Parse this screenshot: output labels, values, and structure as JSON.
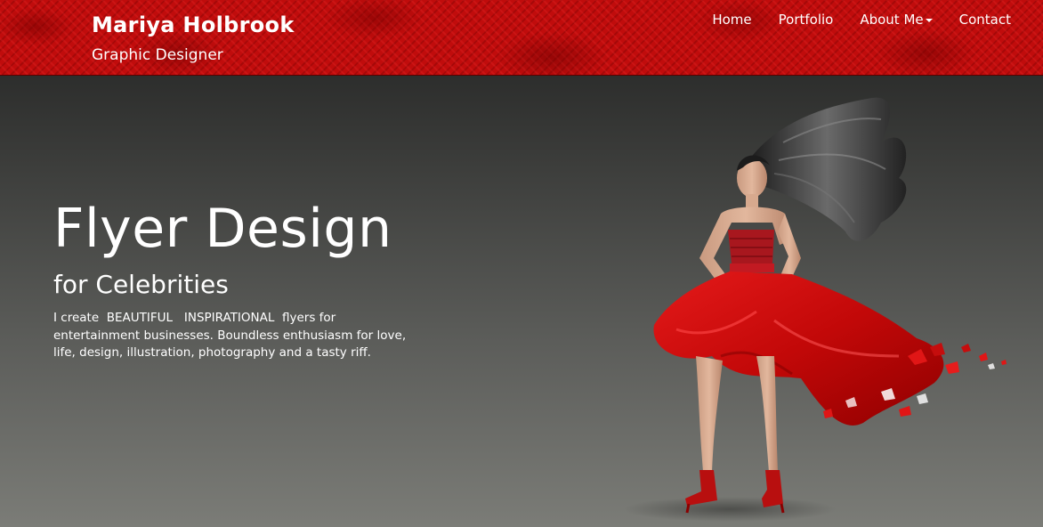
{
  "brand": {
    "name": "Mariya Holbrook",
    "tagline": "Graphic Designer"
  },
  "nav": {
    "items": [
      {
        "label": "Home"
      },
      {
        "label": "Portfolio"
      },
      {
        "label": "About Me",
        "has_dropdown": true
      },
      {
        "label": "Contact"
      }
    ]
  },
  "hero": {
    "title": "Flyer Design",
    "subtitle": "for Celebrities",
    "body": "I create  BEAUTIFUL   INSPIRATIONAL  flyers for entertainment businesses. Boundless enthusiasm for love, life, design, illustration, photography and a tasty riff."
  },
  "colors": {
    "header_red": "#c00c0c",
    "background_top": "#202120",
    "background_bottom": "#7b7c77",
    "dress_red": "#d41010",
    "text": "#ffffff"
  },
  "icons": {
    "dropdown": "caret-down-icon"
  }
}
